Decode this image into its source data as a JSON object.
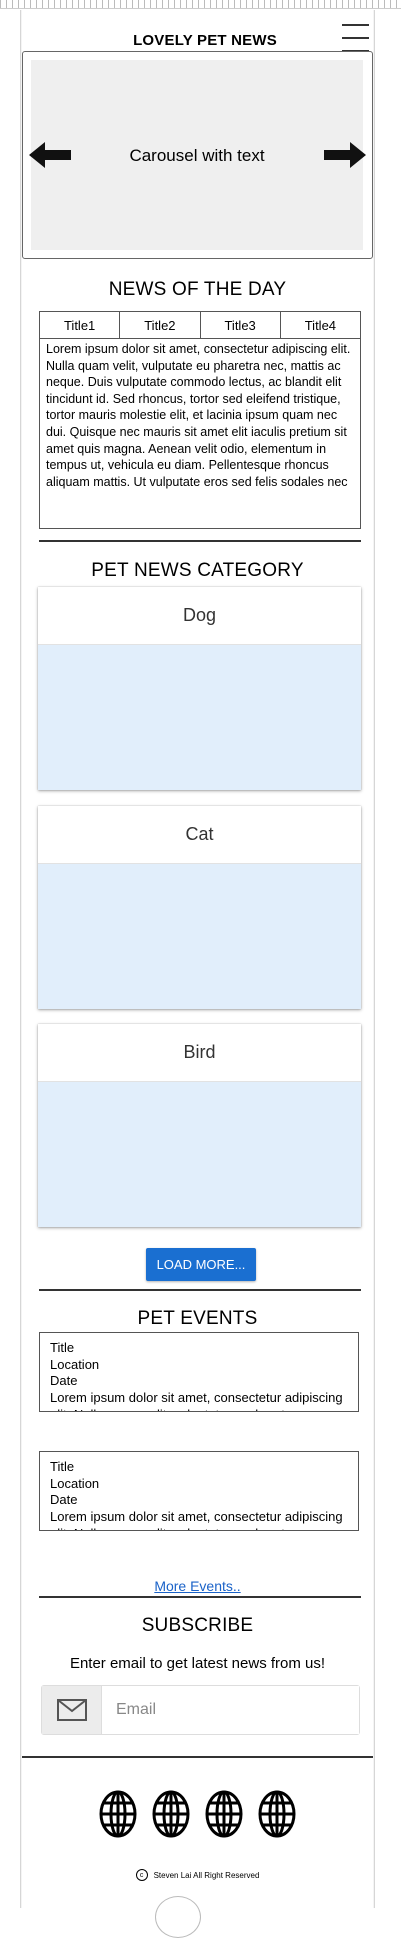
{
  "header": {
    "title": "LOVELY PET NEWS",
    "menu_icon": "hamburger-menu-icon"
  },
  "carousel": {
    "text": "Carousel with text",
    "prev_icon": "arrow-left-icon",
    "next_icon": "arrow-right-icon"
  },
  "news": {
    "title": "NEWS OF THE DAY",
    "tabs": [
      "Title1",
      "Title2",
      "Title3",
      "Title4"
    ],
    "body": "Lorem ipsum dolor sit amet, consectetur adipiscing elit. Nulla quam velit, vulputate eu pharetra nec, mattis ac neque. Duis vulputate commodo lectus, ac blandit elit tincidunt id. Sed rhoncus, tortor sed eleifend tristique, tortor mauris molestie elit, et lacinia ipsum quam nec dui. Quisque nec mauris sit amet elit iaculis pretium sit amet quis magna. Aenean velit odio, elementum in tempus ut, vehicula eu diam. Pellentesque rhoncus aliquam mattis. Ut vulputate eros sed felis sodales nec"
  },
  "categories": {
    "title": "PET NEWS CATEGORY",
    "items": [
      "Dog",
      "Cat",
      "Bird"
    ],
    "load_more": "LOAD MORE..."
  },
  "events": {
    "title": "PET EVENTS",
    "items": [
      {
        "title": "Title",
        "location": "Location",
        "date": "Date",
        "body": "Lorem ipsum dolor sit amet, consectetur adipiscing elit. Nulla quam velit, vulputate eu pharetra nec, mattis ac neque. Duis vulputate commodo lectus,"
      },
      {
        "title": "Title",
        "location": "Location",
        "date": "Date",
        "body": "Lorem ipsum dolor sit amet, consectetur adipiscing elit. Nulla quam velit, vulputate eu pharetra nec, mattis ac neque. Duis vulputate commodo lectus,"
      }
    ],
    "more_link": "More Events.."
  },
  "subscribe": {
    "title": "SUBSCRIBE",
    "description": "Enter email to get latest news from us!",
    "email_placeholder": "Email",
    "email_icon": "envelope-icon"
  },
  "footer": {
    "social_icons": [
      "globe-icon",
      "globe-icon",
      "globe-icon",
      "globe-icon"
    ],
    "copyright_symbol": "c",
    "copyright": "Steven Lai All Right Reserved"
  },
  "colors": {
    "accent": "#1a6fd1",
    "card_body": "#e1eefb",
    "carousel_bg": "#efefef",
    "link": "#1a62c8"
  }
}
